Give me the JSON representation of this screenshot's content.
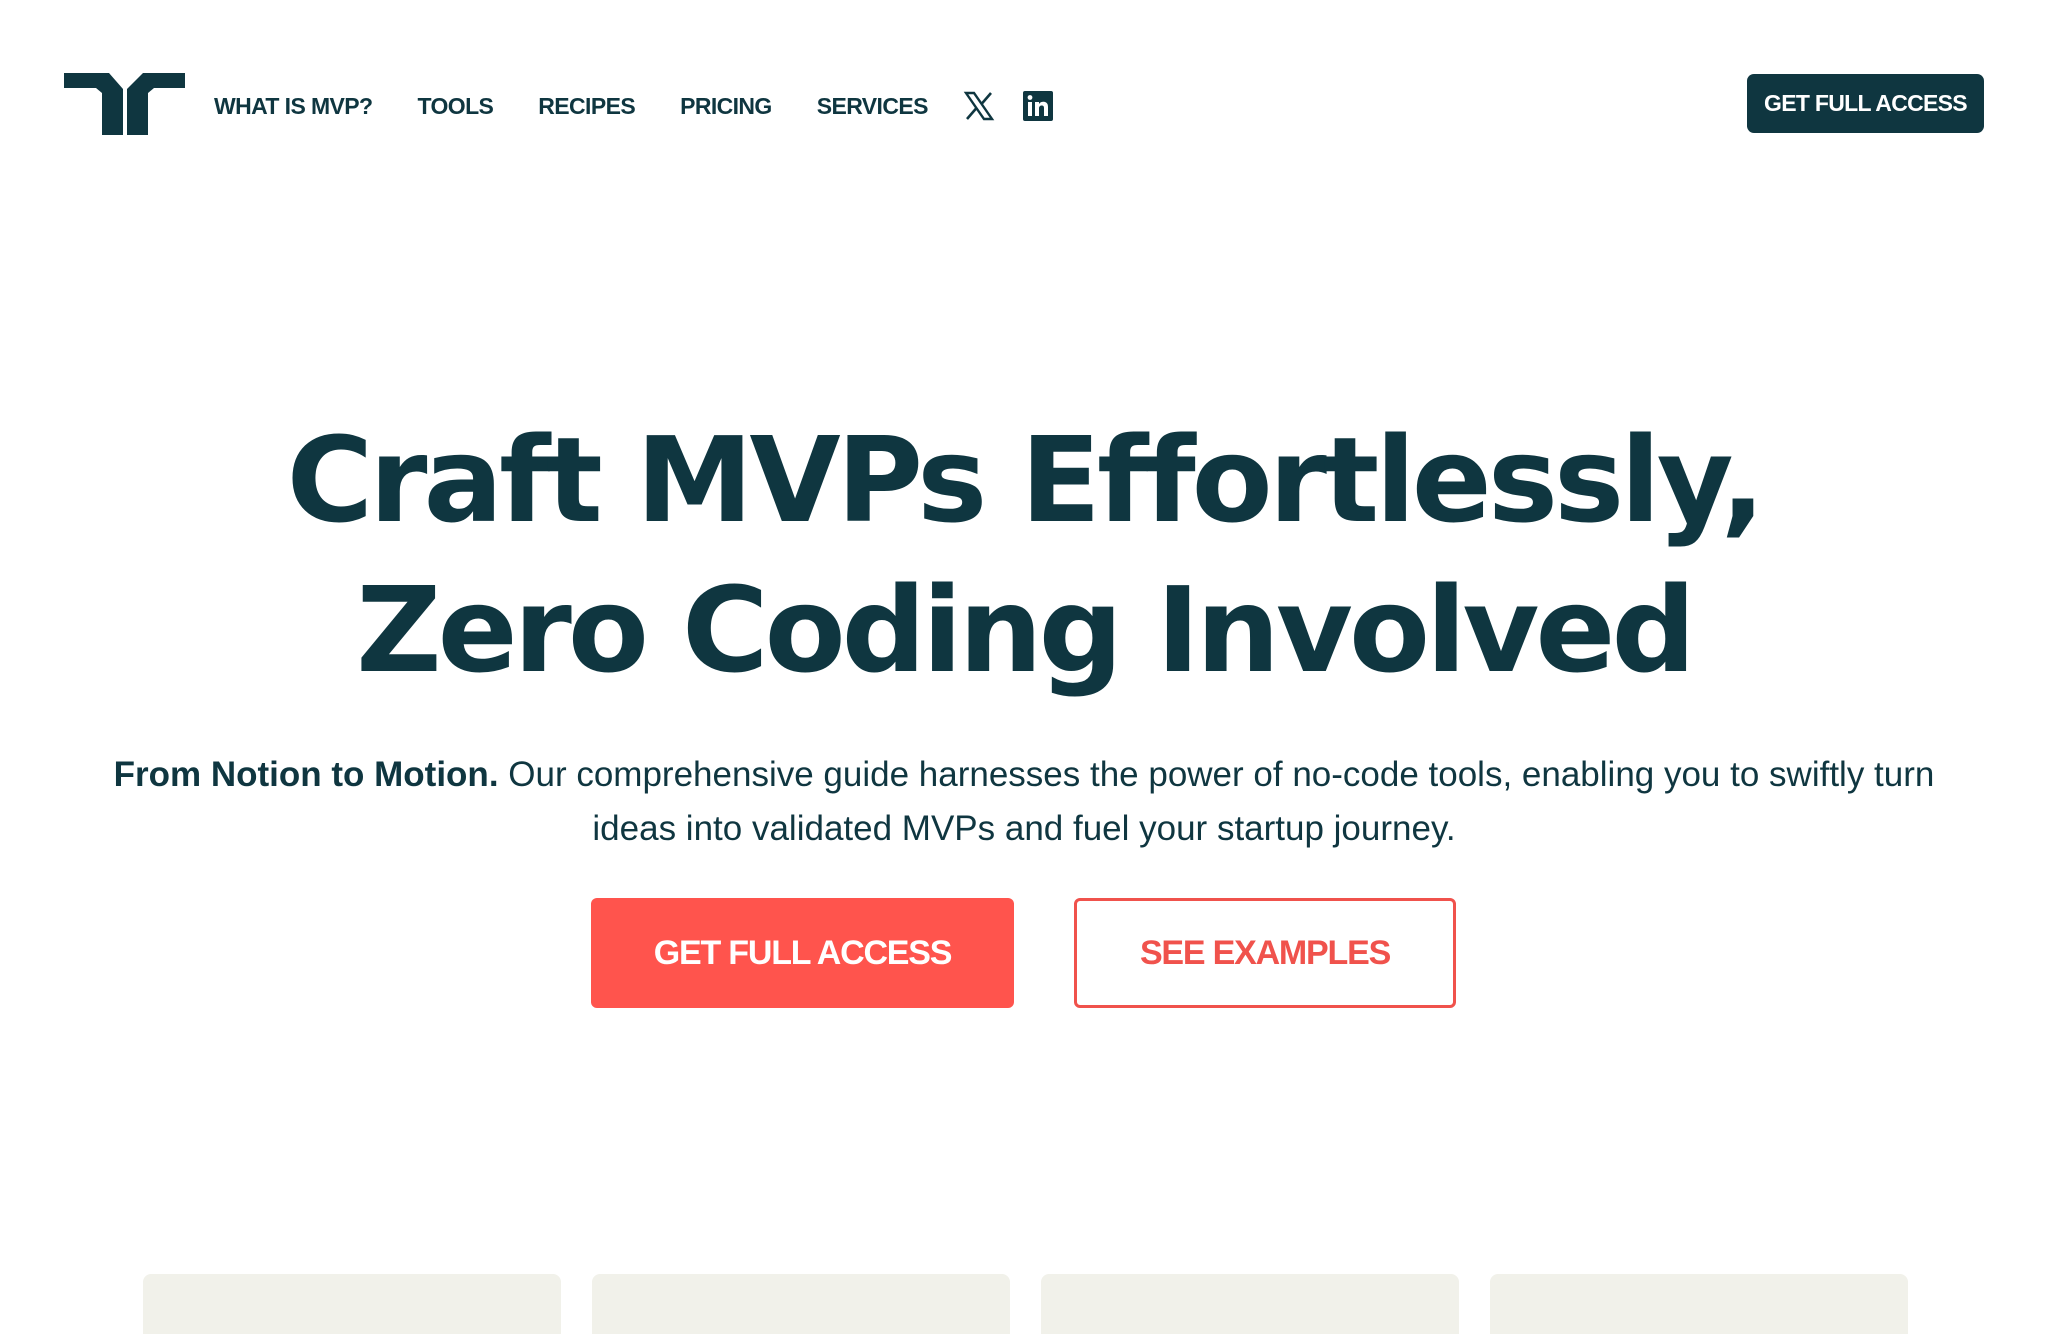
{
  "header": {
    "logo_icon": "brand-logo-icon",
    "nav": [
      {
        "label": "WHAT IS MVP?"
      },
      {
        "label": "TOOLS"
      },
      {
        "label": "RECIPES"
      },
      {
        "label": "PRICING"
      },
      {
        "label": "SERVICES"
      }
    ],
    "social": [
      {
        "icon": "x-twitter-icon"
      },
      {
        "icon": "linkedin-icon"
      }
    ],
    "cta_label": "GET FULL ACCESS"
  },
  "hero": {
    "title_line1": "Craft MVPs Effortlessly,",
    "title_line2": "Zero Coding Involved",
    "subtitle_strong": "From Notion to Motion.",
    "subtitle_rest": " Our comprehensive guide harnesses the power of no-code tools, enabling you to swiftly turn ideas into validated MVPs and fuel your startup journey.",
    "primary_cta": "GET FULL ACCESS",
    "secondary_cta": "SEE EXAMPLES"
  },
  "colors": {
    "brand_dark": "#0f3640",
    "accent_red": "#ff544d",
    "card_bg": "#f1f1ea"
  },
  "cards_count_visible": 4
}
